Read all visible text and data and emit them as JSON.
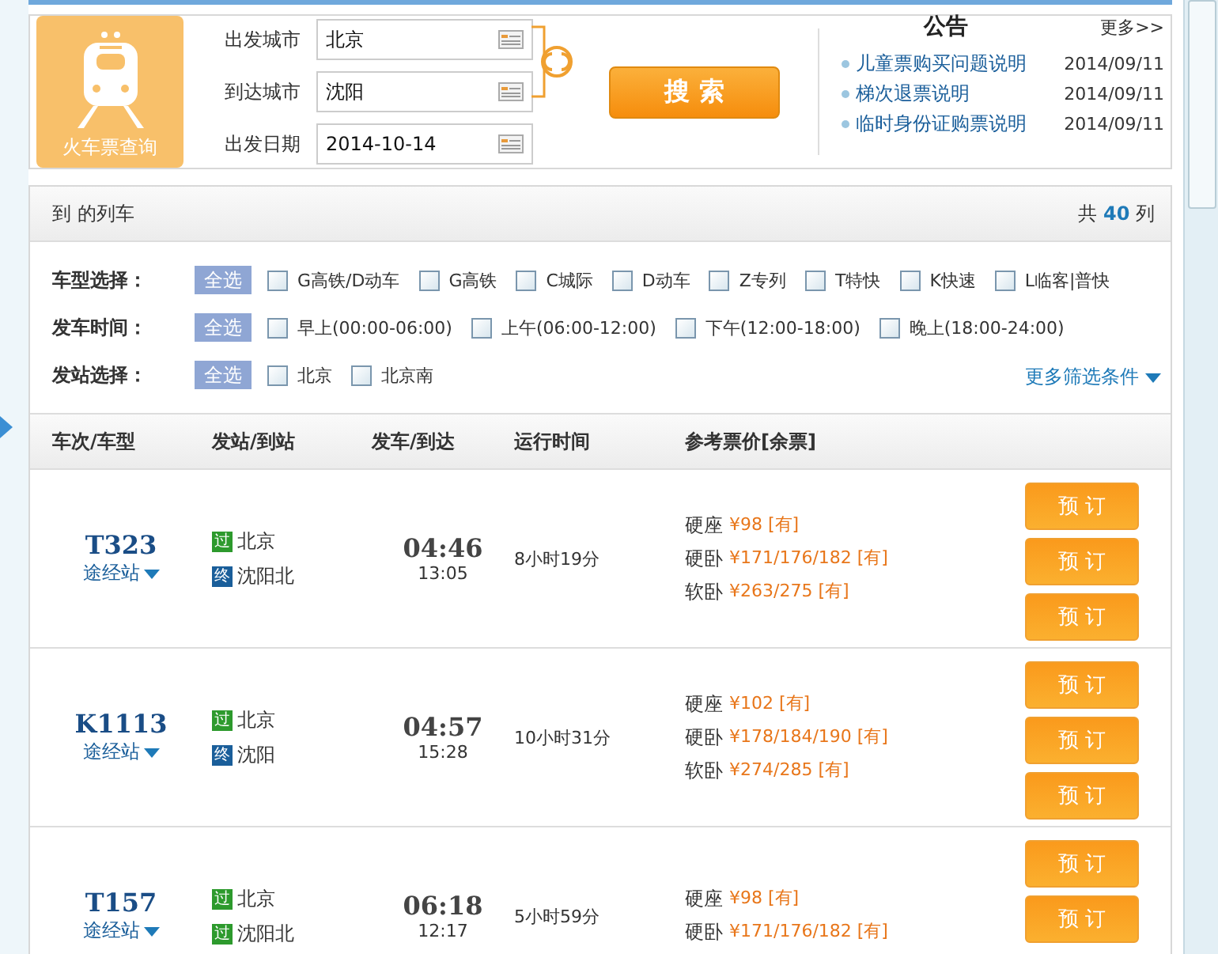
{
  "search_panel": {
    "logo_label": "火车票查询",
    "fields": [
      {
        "label": "出发城市",
        "value": "北京"
      },
      {
        "label": "到达城市",
        "value": "沈阳"
      },
      {
        "label": "出发日期",
        "value": "2014-10-14"
      }
    ],
    "search_button": "搜 索"
  },
  "notice": {
    "title": "公告",
    "more": "更多>>",
    "items": [
      {
        "text": "儿童票购买问题说明",
        "date": "2014/09/11"
      },
      {
        "text": "梯次退票说明",
        "date": "2014/09/11"
      },
      {
        "text": "临时身份证购票说明",
        "date": "2014/09/11"
      }
    ]
  },
  "results": {
    "title": "到 的列车",
    "count_prefix": "共",
    "count": "40",
    "count_suffix": "列"
  },
  "filters": [
    {
      "label": "车型选择：",
      "all": "全选",
      "all_selected": true,
      "options": [
        {
          "label": "G高铁/D动车",
          "checked": false
        },
        {
          "label": "G高铁",
          "checked": false
        },
        {
          "label": "C城际",
          "checked": false
        },
        {
          "label": "D动车",
          "checked": false
        },
        {
          "label": "Z专列",
          "checked": false
        },
        {
          "label": "T特快",
          "checked": false
        },
        {
          "label": "K快速",
          "checked": false
        },
        {
          "label": "L临客|普快",
          "checked": false
        }
      ]
    },
    {
      "label": "发车时间：",
      "all": "全选",
      "all_selected": true,
      "options": [
        {
          "label": "早上(00:00-06:00)",
          "checked": false
        },
        {
          "label": "上午(06:00-12:00)",
          "checked": false
        },
        {
          "label": "下午(12:00-18:00)",
          "checked": false
        },
        {
          "label": "晚上(18:00-24:00)",
          "checked": false
        }
      ]
    },
    {
      "label": "发站选择：",
      "all": "全选",
      "all_selected": true,
      "options": [
        {
          "label": "北京",
          "checked": false
        },
        {
          "label": "北京南",
          "checked": false
        }
      ]
    }
  ],
  "more_filters": "更多筛选条件",
  "table": {
    "columns": [
      "车次/车型",
      "发站/到站",
      "发车/到达",
      "运行时间",
      "参考票价[余票]"
    ],
    "rows": [
      {
        "train": "T323",
        "stops": "途经站",
        "from": {
          "kind": "pass",
          "badge": "过",
          "name": "北京"
        },
        "to": {
          "kind": "end",
          "badge": "终",
          "name": "沈阳北"
        },
        "depart": "04:46",
        "arrive": "13:05",
        "duration": "8小时19分",
        "prices": [
          {
            "seat": "硬座",
            "price": "¥98 [有]"
          },
          {
            "seat": "硬卧",
            "price": "¥171/176/182 [有]"
          },
          {
            "seat": "软卧",
            "price": "¥263/275 [有]"
          }
        ],
        "buttons": [
          "预 订",
          "预 订",
          "预 订"
        ]
      },
      {
        "train": "K1113",
        "stops": "途经站",
        "from": {
          "kind": "pass",
          "badge": "过",
          "name": "北京"
        },
        "to": {
          "kind": "end",
          "badge": "终",
          "name": "沈阳"
        },
        "depart": "04:57",
        "arrive": "15:28",
        "duration": "10小时31分",
        "prices": [
          {
            "seat": "硬座",
            "price": "¥102 [有]"
          },
          {
            "seat": "硬卧",
            "price": "¥178/184/190 [有]"
          },
          {
            "seat": "软卧",
            "price": "¥274/285 [有]"
          }
        ],
        "buttons": [
          "预 订",
          "预 订",
          "预 订"
        ]
      },
      {
        "train": "T157",
        "stops": "途经站",
        "from": {
          "kind": "pass",
          "badge": "过",
          "name": "北京"
        },
        "to": {
          "kind": "pass",
          "badge": "过",
          "name": "沈阳北"
        },
        "depart": "06:18",
        "arrive": "12:17",
        "duration": "5小时59分",
        "prices": [
          {
            "seat": "硬座",
            "price": "¥98 [有]"
          },
          {
            "seat": "硬卧",
            "price": "¥171/176/182 [有]"
          }
        ],
        "buttons": [
          "预 订",
          "预 订"
        ]
      }
    ]
  }
}
